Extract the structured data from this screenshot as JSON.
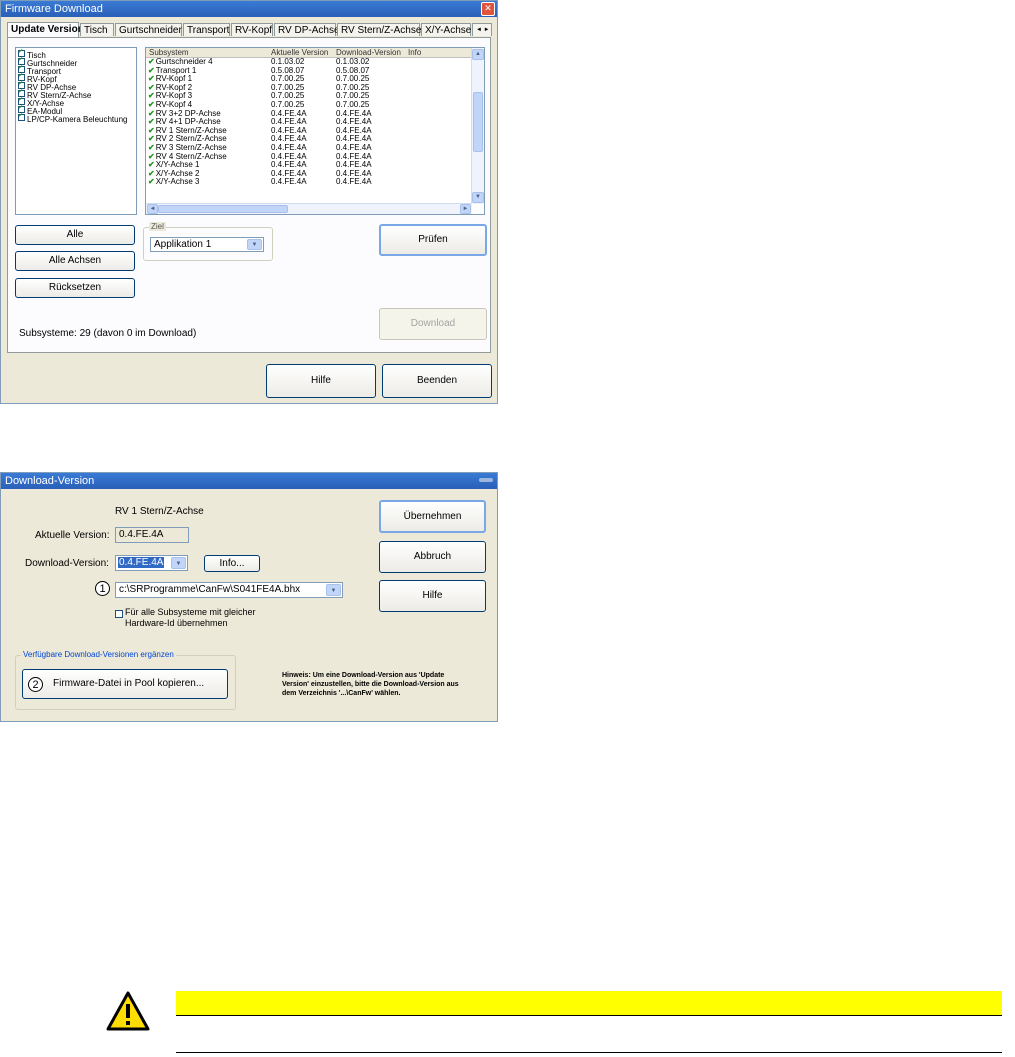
{
  "fw": {
    "title": "Firmware Download",
    "tabs": [
      "Update Version",
      "Tisch",
      "Gurtschneider",
      "Transport",
      "RV-Kopf",
      "RV DP-Achse",
      "RV Stern/Z-Achse",
      "X/Y-Achse"
    ],
    "subsystem_list": [
      "Tisch",
      "Gurtschneider",
      "Transport",
      "RV-Kopf",
      "RV DP-Achse",
      "RV Stern/Z-Achse",
      "X/Y-Achse",
      "EA-Modul",
      "LP/CP-Kamera Beleuchtung"
    ],
    "table_headers": {
      "subsystem": "Subsystem",
      "current": "Aktuelle Version",
      "download": "Download-Version",
      "info": "Info"
    },
    "table_rows": [
      {
        "name": "Gurtschneider 4",
        "current": "0.1.03.02",
        "download": "0.1.03.02"
      },
      {
        "name": "Transport 1",
        "current": "0.5.08.07",
        "download": "0.5.08.07"
      },
      {
        "name": "RV-Kopf 1",
        "current": "0.7.00.25",
        "download": "0.7.00.25"
      },
      {
        "name": "RV-Kopf 2",
        "current": "0.7.00.25",
        "download": "0.7.00.25"
      },
      {
        "name": "RV-Kopf 3",
        "current": "0.7.00.25",
        "download": "0.7.00.25"
      },
      {
        "name": "RV-Kopf 4",
        "current": "0.7.00.25",
        "download": "0.7.00.25"
      },
      {
        "name": "RV 3+2 DP-Achse",
        "current": "0.4.FE.4A",
        "download": "0.4.FE.4A"
      },
      {
        "name": "RV 4+1 DP-Achse",
        "current": "0.4.FE.4A",
        "download": "0.4.FE.4A"
      },
      {
        "name": "RV 1 Stern/Z-Achse",
        "current": "0.4.FE.4A",
        "download": "0.4.FE.4A"
      },
      {
        "name": "RV 2 Stern/Z-Achse",
        "current": "0.4.FE.4A",
        "download": "0.4.FE.4A"
      },
      {
        "name": "RV 3 Stern/Z-Achse",
        "current": "0.4.FE.4A",
        "download": "0.4.FE.4A"
      },
      {
        "name": "RV 4 Stern/Z-Achse",
        "current": "0.4.FE.4A",
        "download": "0.4.FE.4A"
      },
      {
        "name": "X/Y-Achse 1",
        "current": "0.4.FE.4A",
        "download": "0.4.FE.4A"
      },
      {
        "name": "X/Y-Achse 2",
        "current": "0.4.FE.4A",
        "download": "0.4.FE.4A"
      },
      {
        "name": "X/Y-Achse 3",
        "current": "0.4.FE.4A",
        "download": "0.4.FE.4A"
      }
    ],
    "buttons": {
      "alle": "Alle",
      "alle_achsen": "Alle Achsen",
      "ruecksetzen": "Rücksetzen",
      "pruefen": "Prüfen",
      "download": "Download",
      "hilfe": "Hilfe",
      "beenden": "Beenden"
    },
    "ziel_label": "Ziel",
    "ziel_value": "Applikation 1",
    "status": "Subsysteme: 29 (davon 0 im Download)"
  },
  "dv": {
    "title": "Download-Version",
    "subsystem_name": "RV 1 Stern/Z-Achse",
    "current_label": "Aktuelle Version:",
    "current_value": "0.4.FE.4A",
    "download_label": "Download-Version:",
    "download_value": "0.4.FE.4A",
    "info_button": "Info...",
    "marker1": "1",
    "path_value": "c:\\SRProgramme\\CanFw\\S041FE4A.bhx",
    "checkbox_line1": "Für alle Subsysteme mit gleicher",
    "checkbox_line2": "Hardware-Id übernehmen",
    "group_label": "Verfügbare Download-Versionen ergänzen",
    "marker2": "2",
    "copy_button": "Firmware-Datei in Pool kopieren...",
    "hint_line1": "Hinweis: Um eine Download-Version aus 'Update",
    "hint_line2": "Version' einzustellen, bitte die Download-Version aus",
    "hint_line3": "dem Verzeichnis '...\\CanFw' wählen.",
    "buttons": {
      "uebernehmen": "Übernehmen",
      "abbruch": "Abbruch",
      "hilfe": "Hilfe"
    }
  },
  "warning": {
    "icon": "warning-triangle-icon",
    "bar_color": "#ffff00"
  }
}
